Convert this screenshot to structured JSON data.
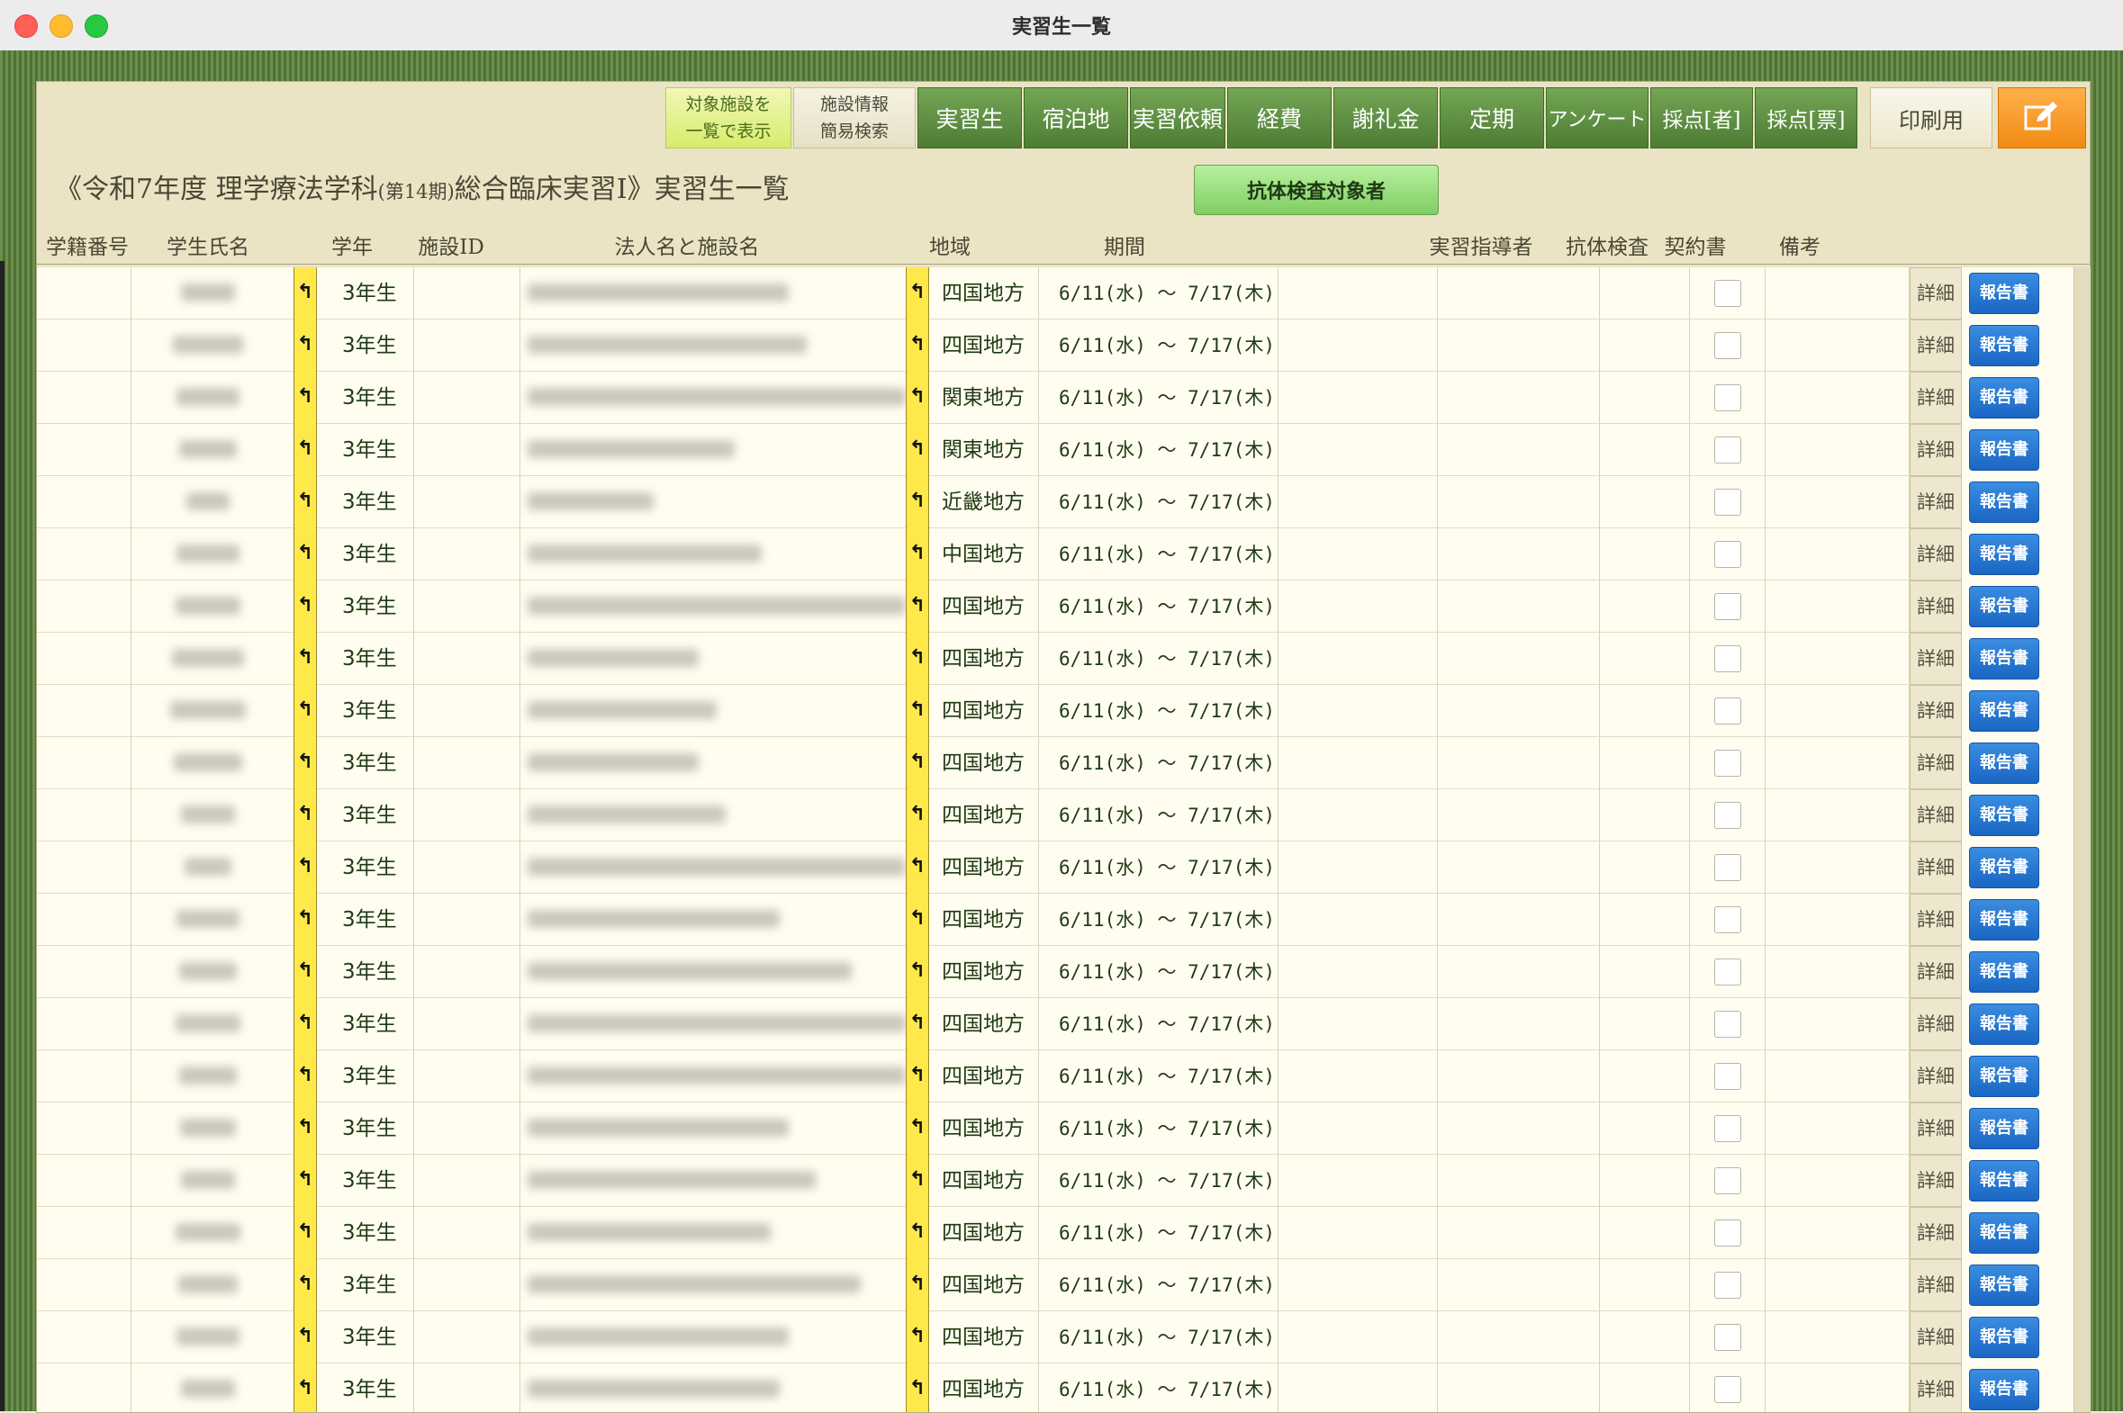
{
  "window": {
    "title": "実習生一覧"
  },
  "toolbar": {
    "show_facilities": "対象施設を\n一覧で表示",
    "facility_search": "施設情報\n簡易検索",
    "tabs": [
      "実習生",
      "宿泊地",
      "実習依頼",
      "経費",
      "謝礼金",
      "定期",
      "アンケート",
      "採点[者]",
      "採点[票]"
    ],
    "print": "印刷用",
    "edit_icon": "pencil-square-icon"
  },
  "heading": {
    "prefix": "《令和7年度 理学療法学科",
    "term": "(第14期)",
    "suffix": "総合臨床実習Ⅰ》実習生一覧"
  },
  "antibody_button": "抗体検査対象者",
  "columns": {
    "student_no": "学籍番号",
    "name": "学生氏名",
    "year": "学年",
    "facility_id": "施設ID",
    "facility": "法人名と施設名",
    "region": "地域",
    "period": "期間",
    "supervisor": "実習指導者",
    "antibody": "抗体検査",
    "contract": "契約書",
    "notes": "備考"
  },
  "row_labels": {
    "detail": "詳細",
    "report": "報告書",
    "jump": "↰"
  },
  "rows": [
    {
      "year": "3年生",
      "region": "四国地方",
      "period": "6/11(水) 〜 7/17(木)"
    },
    {
      "year": "3年生",
      "region": "四国地方",
      "period": "6/11(水) 〜 7/17(木)"
    },
    {
      "year": "3年生",
      "region": "関東地方",
      "period": "6/11(水) 〜 7/17(木)"
    },
    {
      "year": "3年生",
      "region": "関東地方",
      "period": "6/11(水) 〜 7/17(木)"
    },
    {
      "year": "3年生",
      "region": "近畿地方",
      "period": "6/11(水) 〜 7/17(木)"
    },
    {
      "year": "3年生",
      "region": "中国地方",
      "period": "6/11(水) 〜 7/17(木)"
    },
    {
      "year": "3年生",
      "region": "四国地方",
      "period": "6/11(水) 〜 7/17(木)"
    },
    {
      "year": "3年生",
      "region": "四国地方",
      "period": "6/11(水) 〜 7/17(木)"
    },
    {
      "year": "3年生",
      "region": "四国地方",
      "period": "6/11(水) 〜 7/17(木)"
    },
    {
      "year": "3年生",
      "region": "四国地方",
      "period": "6/11(水) 〜 7/17(木)"
    },
    {
      "year": "3年生",
      "region": "四国地方",
      "period": "6/11(水) 〜 7/17(木)"
    },
    {
      "year": "3年生",
      "region": "四国地方",
      "period": "6/11(水) 〜 7/17(木)"
    },
    {
      "year": "3年生",
      "region": "四国地方",
      "period": "6/11(水) 〜 7/17(木)"
    },
    {
      "year": "3年生",
      "region": "四国地方",
      "period": "6/11(水) 〜 7/17(木)"
    },
    {
      "year": "3年生",
      "region": "四国地方",
      "period": "6/11(水) 〜 7/17(木)"
    },
    {
      "year": "3年生",
      "region": "四国地方",
      "period": "6/11(水) 〜 7/17(木)"
    },
    {
      "year": "3年生",
      "region": "四国地方",
      "period": "6/11(水) 〜 7/17(木)"
    },
    {
      "year": "3年生",
      "region": "四国地方",
      "period": "6/11(水) 〜 7/17(木)"
    },
    {
      "year": "3年生",
      "region": "四国地方",
      "period": "6/11(水) 〜 7/17(木)"
    },
    {
      "year": "3年生",
      "region": "四国地方",
      "period": "6/11(水) 〜 7/17(木)"
    },
    {
      "year": "3年生",
      "region": "四国地方",
      "period": "6/11(水) 〜 7/17(木)"
    },
    {
      "year": "3年生",
      "region": "四国地方",
      "period": "6/11(水) 〜 7/17(木)"
    }
  ]
}
